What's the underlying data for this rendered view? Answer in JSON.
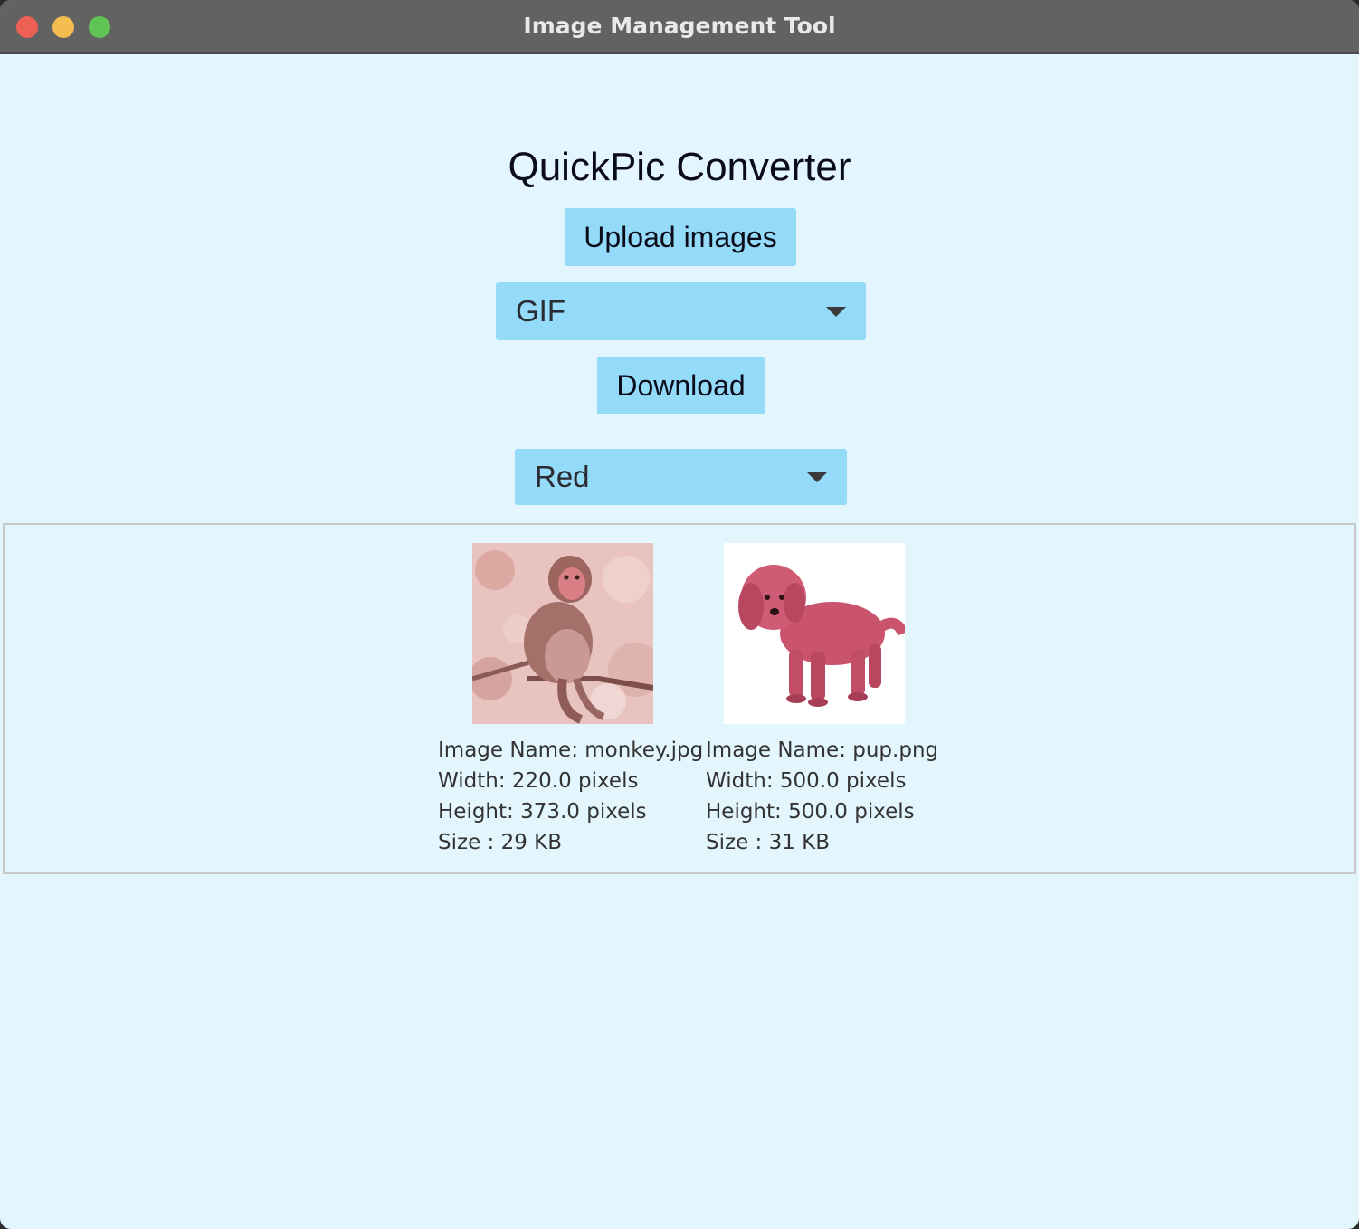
{
  "window": {
    "title": "Image Management Tool"
  },
  "app": {
    "heading": "QuickPic Converter",
    "upload_label": "Upload images",
    "format_selected": "GIF",
    "download_label": "Download",
    "filter_selected": "Red"
  },
  "images": [
    {
      "name_line": "Image Name: monkey.jpg",
      "width_line": "Width: 220.0 pixels",
      "height_line": "Height: 373.0 pixels",
      "size_line": "Size : 29 KB"
    },
    {
      "name_line": "Image Name: pup.png",
      "width_line": "Width: 500.0 pixels",
      "height_line": "Height: 500.0 pixels",
      "size_line": "Size : 31 KB"
    }
  ],
  "colors": {
    "background": "#e3f5fd",
    "button": "#93dbf8",
    "titlebar": "#626262"
  }
}
